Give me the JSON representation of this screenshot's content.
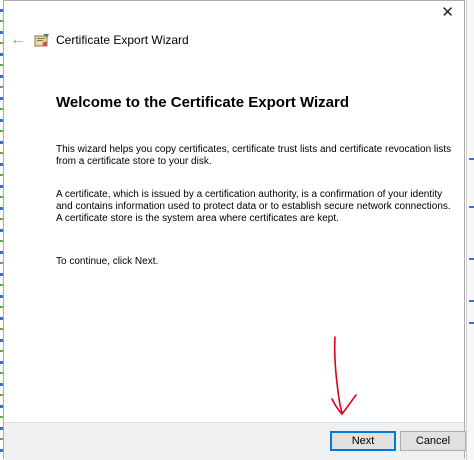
{
  "window": {
    "title": "Certificate Export Wizard",
    "close_glyph": "✕",
    "back_glyph": "←"
  },
  "content": {
    "heading": "Welcome to the Certificate Export Wizard",
    "paragraph1": "This wizard helps you copy certificates, certificate trust lists and certificate revocation lists from a certificate store to your disk.",
    "paragraph2": "A certificate, which is issued by a certification authority, is a confirmation of your identity and contains information used to protect data or to establish secure network connections. A certificate store is the system area where certificates are kept.",
    "paragraph3": "To continue, click Next."
  },
  "footer": {
    "next_label": "Next",
    "cancel_label": "Cancel"
  },
  "annotation": {
    "icon": "red-hand-drawn-arrow-icon",
    "color": "#e0001b"
  },
  "colors": {
    "accent": "#0078d7",
    "footer_bg": "#f0f0f0"
  }
}
